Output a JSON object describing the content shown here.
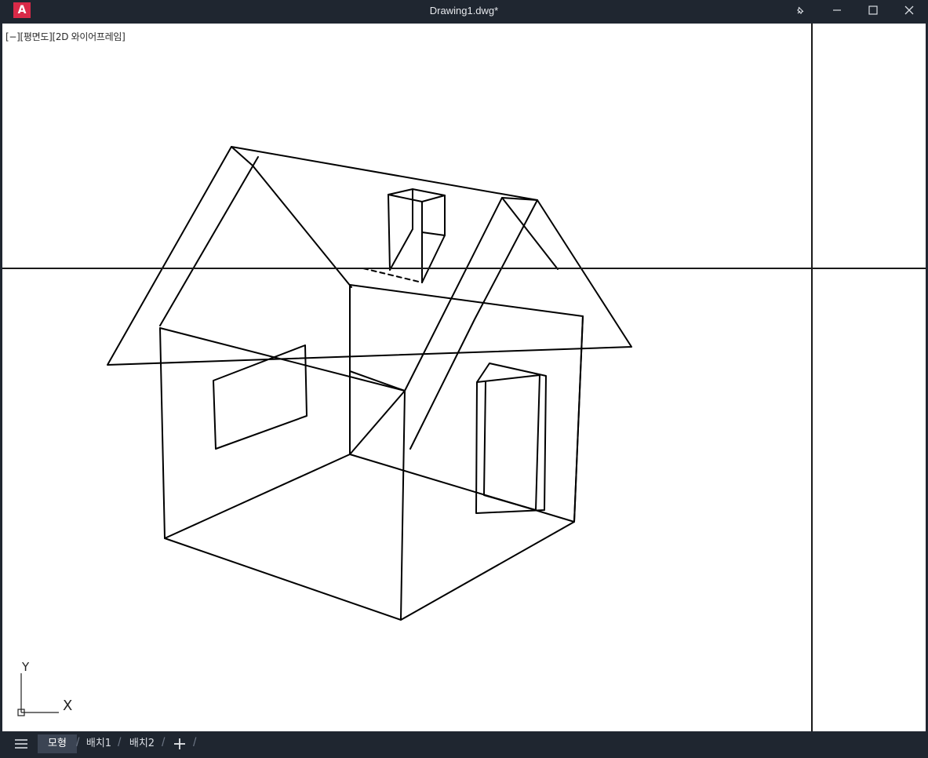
{
  "window": {
    "app_icon_letter": "A",
    "title": "Drawing1.dwg*",
    "controls": [
      "pin-icon",
      "minimize-icon",
      "maximize-icon",
      "close-icon"
    ]
  },
  "viewport": {
    "label": "[−][평면도][2D 와이어프레임]",
    "ucs": {
      "y_label": "Y",
      "x_label": "X"
    }
  },
  "tabs": {
    "menu_icon": "hamburger-icon",
    "items": [
      {
        "label": "모형",
        "active": true
      },
      {
        "label": "배치1",
        "active": false
      },
      {
        "label": "배치2",
        "active": false
      }
    ],
    "add_icon": "plus-icon"
  },
  "colors": {
    "chrome": "#1f2630",
    "accent": "#d92a48",
    "canvas": "#ffffff",
    "active_tab": "#3b4453"
  }
}
